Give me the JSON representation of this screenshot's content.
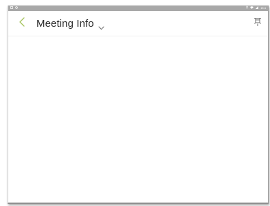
{
  "status_bar": {
    "left_icons": [
      "notification-icon",
      "sync-icon"
    ],
    "right_icons": [
      "bluetooth-icon",
      "wifi-icon",
      "signal-icon"
    ],
    "time": "15:4"
  },
  "header": {
    "title": "Meeting Info",
    "back_icon": "chevron-left-icon",
    "dropdown_icon": "chevron-down-icon",
    "action_icon": "pin-icon"
  },
  "colors": {
    "accent": "#a5c25a",
    "status_bar": "#a8a8a8",
    "title_text": "#2c2c2c",
    "icon_gray": "#6d6d6d"
  }
}
